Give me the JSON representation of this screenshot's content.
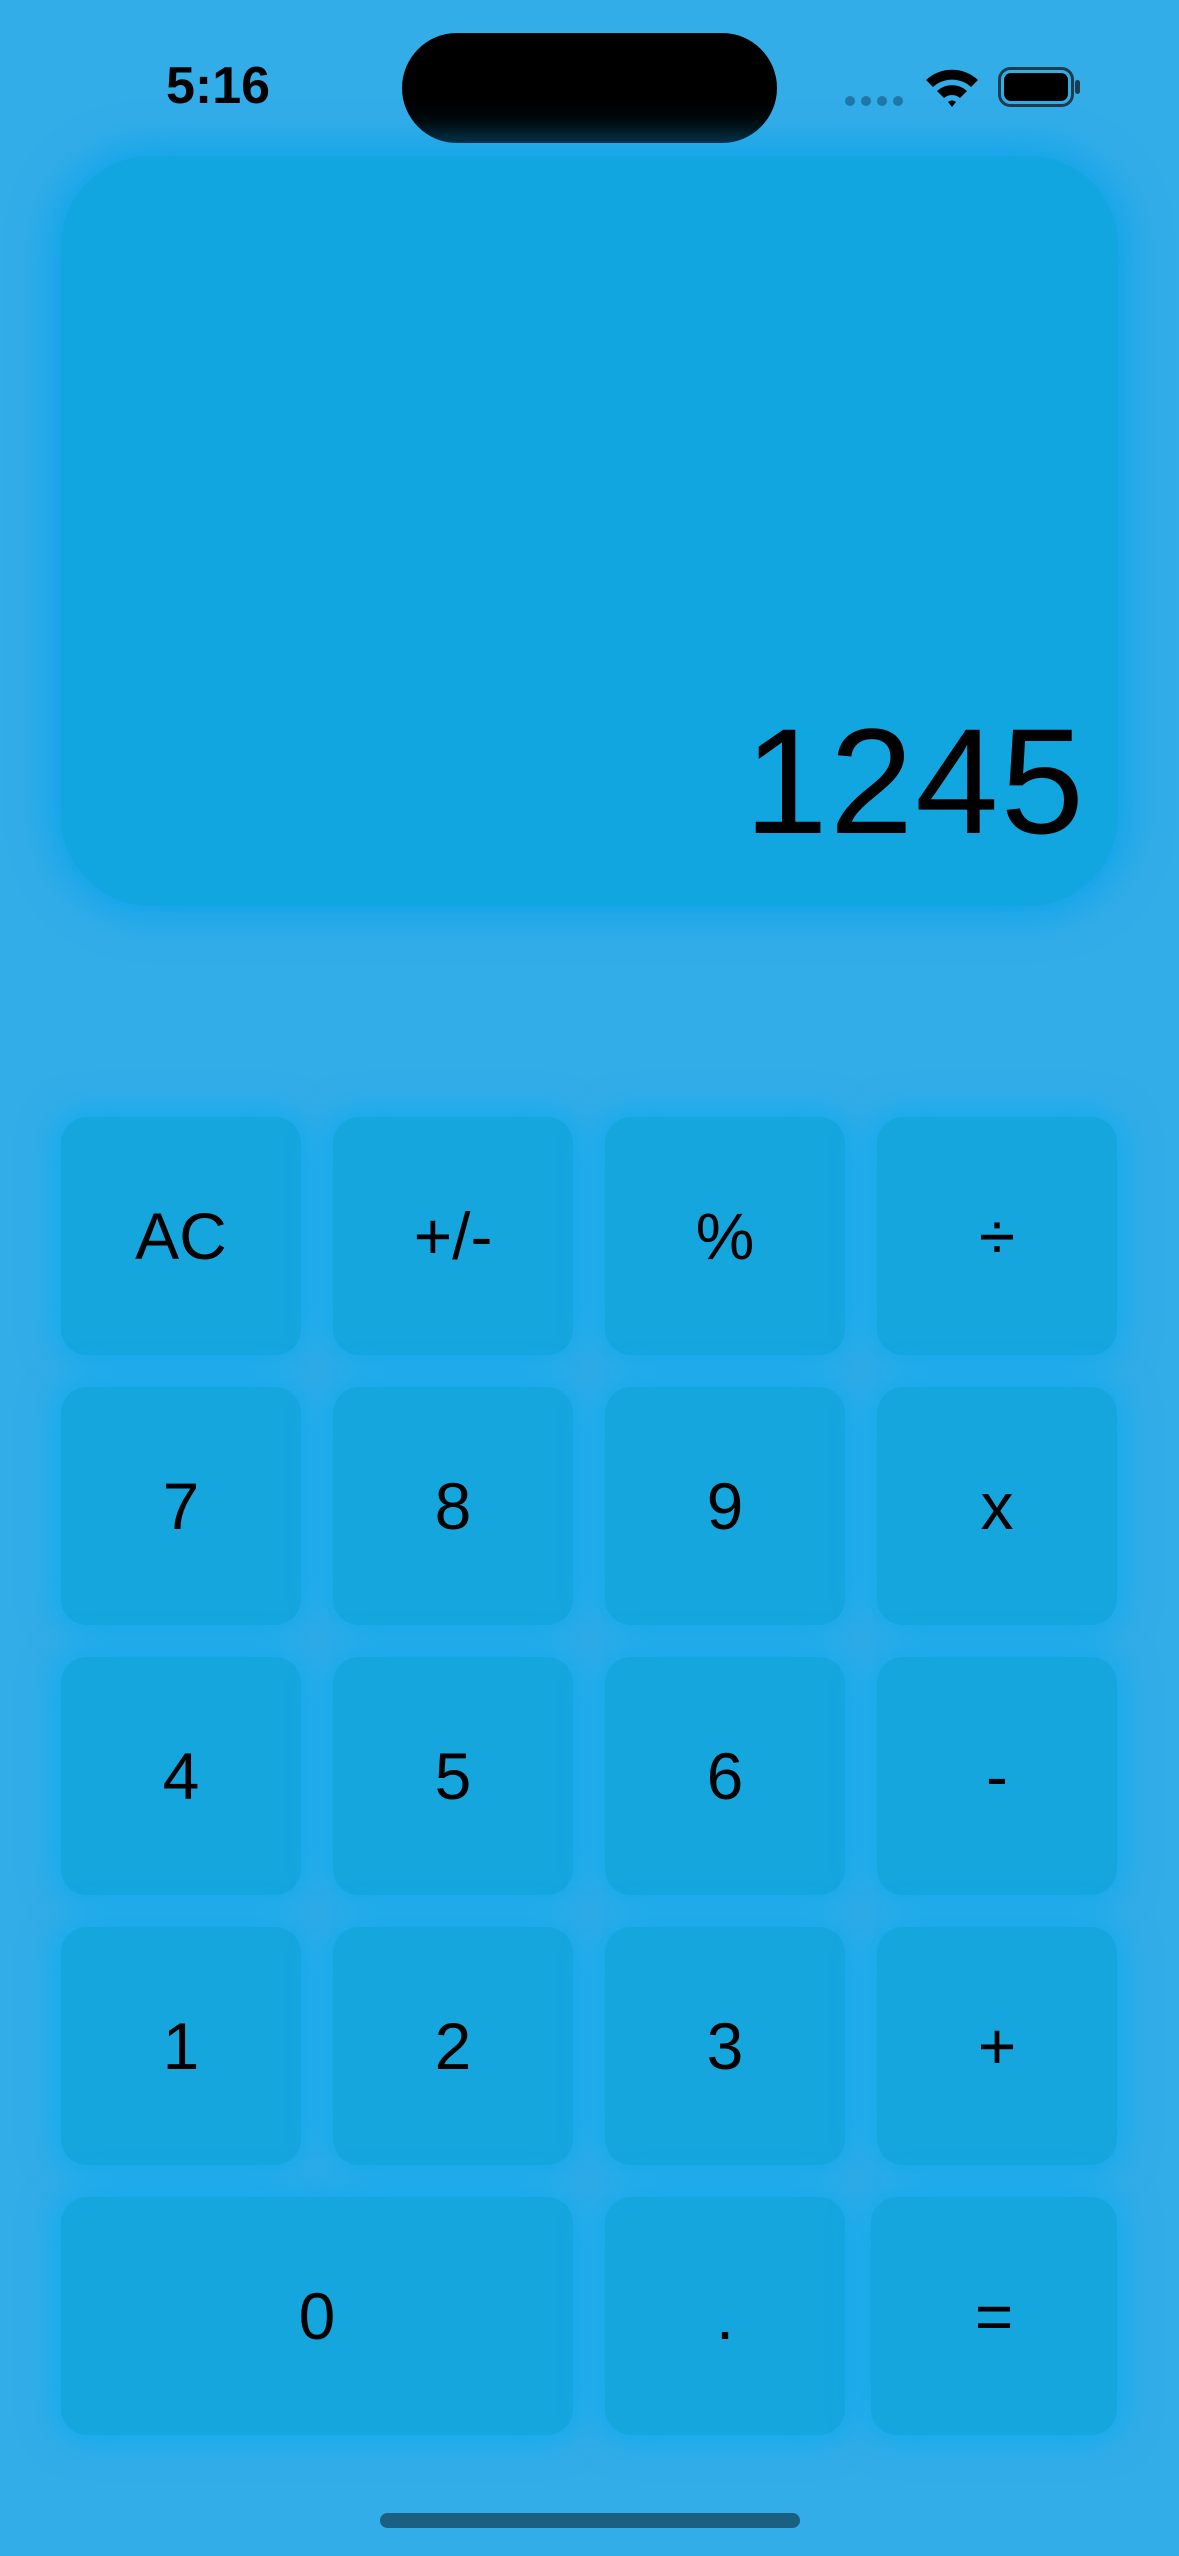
{
  "status_bar": {
    "time": "5:16",
    "icons": [
      "signal-dots-icon",
      "wifi-icon",
      "battery-icon"
    ]
  },
  "display": {
    "value": "1245"
  },
  "keypad": {
    "row1": [
      "AC",
      "+/-",
      "%",
      "÷"
    ],
    "row2": [
      "7",
      "8",
      "9",
      "x"
    ],
    "row3": [
      "4",
      "5",
      "6",
      "-"
    ],
    "row4": [
      "1",
      "2",
      "3",
      "+"
    ],
    "row5": [
      "0",
      ".",
      "="
    ]
  },
  "colors": {
    "background": "#33ade8",
    "panel": "#12a6e0",
    "key": "#15a6de",
    "glow": "#00aaf0",
    "text": "#000000"
  }
}
